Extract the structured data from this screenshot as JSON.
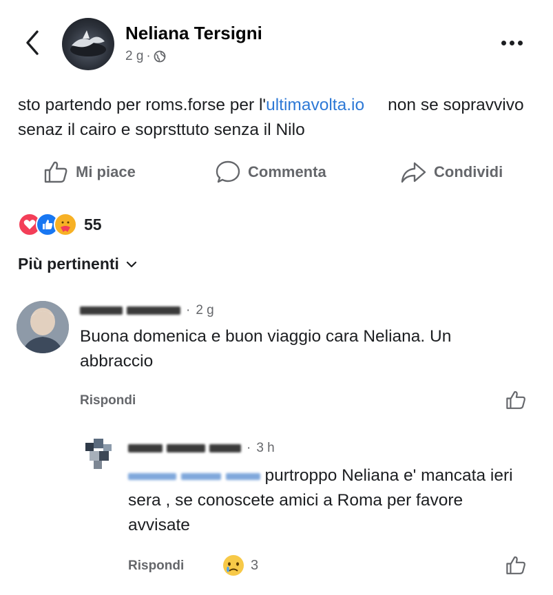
{
  "post": {
    "author": "Neliana Tersigni",
    "time": "2 g",
    "visibility_icon": "globe-icon",
    "text_part1": "sto partendo per roms.forse per l'",
    "text_link": "ultimavolta.io",
    "text_part2": "non se sopravvivo senaz il cairo e soprsttuto senza il Nilo"
  },
  "actions": {
    "like": "Mi piace",
    "comment": "Commenta",
    "share": "Condividi"
  },
  "reactions": {
    "icons": [
      "love-reaction-icon",
      "like-reaction-icon",
      "care-reaction-icon"
    ],
    "count": "55"
  },
  "sort_label": "Più pertinenti",
  "comments": [
    {
      "time": "2 g",
      "text": "Buona domenica e buon  viaggio cara Neliana. Un abbraccio",
      "reply_label": "Rispondi"
    },
    {
      "time": "3 h",
      "text": "purtroppo Neliana e' mancata ieri sera , se conoscete amici a Roma per favore avvisate",
      "reply_label": "Rispondi",
      "reaction_icon": "sad-reaction-icon",
      "reaction_count": "3"
    }
  ],
  "colors": {
    "link": "#2e79d6",
    "secondary_text": "#65676b",
    "primary_text": "#1c1e21"
  }
}
